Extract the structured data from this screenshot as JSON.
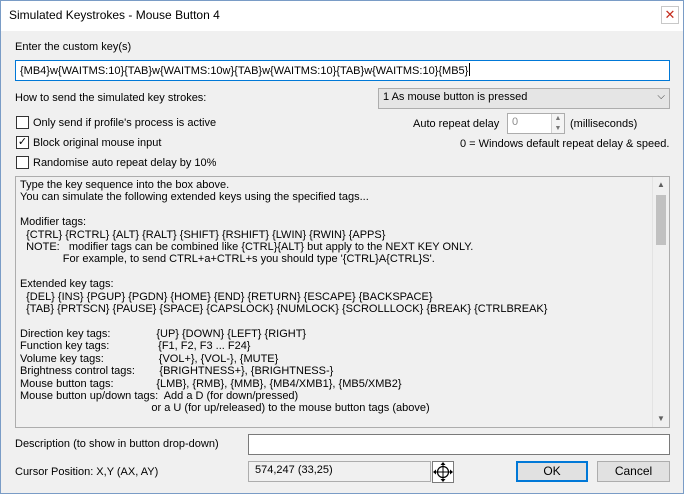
{
  "window": {
    "title": "Simulated Keystrokes - Mouse Button 4",
    "close_glyph": "✕"
  },
  "custom_key": {
    "label": "Enter the custom key(s)",
    "value": "{MB4}w{WAITMS:10}{TAB}w{WAITMS:10w}{TAB}w{WAITMS:10}{TAB}w{WAITMS:10}{MB5}"
  },
  "send_mode": {
    "label": "How to send the simulated key strokes:",
    "selected": "1 As mouse button is pressed",
    "arrow_icon": "chevron-down-icon"
  },
  "options": {
    "only_profile": {
      "label": "Only send if profile's process is active",
      "checked": false
    },
    "block_original": {
      "label": "Block original mouse input",
      "checked": true
    },
    "randomise": {
      "label": "Randomise auto repeat delay by 10%",
      "checked": false
    }
  },
  "auto_repeat": {
    "label": "Auto repeat delay",
    "value": "0",
    "unit": "(milliseconds)",
    "note": "0 = Windows default repeat delay & speed."
  },
  "help": {
    "text": "Type the key sequence into the box above.\nYou can simulate the following extended keys using the specified tags...\n\nModifier tags:\n  {CTRL} {RCTRL} {ALT} {RALT} {SHIFT} {RSHIFT} {LWIN} {RWIN} {APPS}\n  NOTE:   modifier tags can be combined like {CTRL}{ALT} but apply to the NEXT KEY ONLY.\n              For example, to send CTRL+a+CTRL+s you should type '{CTRL}A{CTRL}S'.\n\nExtended key tags:\n  {DEL} {INS} {PGUP} {PGDN} {HOME} {END} {RETURN} {ESCAPE} {BACKSPACE}\n  {TAB} {PRTSCN} {PAUSE} {SPACE} {CAPSLOCK} {NUMLOCK} {SCROLLLOCK} {BREAK} {CTRLBREAK}\n\nDirection key tags:               {UP} {DOWN} {LEFT} {RIGHT}\nFunction key tags:                {F1, F2, F3 ... F24}\nVolume key tags:                  {VOL+}, {VOL-}, {MUTE}\nBrightness control tags:        {BRIGHTNESS+}, {BRIGHTNESS-}\nMouse button tags:              {LMB}, {RMB}, {MMB}, {MB4/XMB1}, {MB5/XMB2}\nMouse button up/down tags:  Add a D (for down/pressed)\n                                           or a U (for up/released) to the mouse button tags (above)"
  },
  "description": {
    "label": "Description (to show in button drop-down)",
    "value": ""
  },
  "cursor": {
    "label": "Cursor Position: X,Y (AX, AY)",
    "value": "574,247 (33,25)",
    "target_icon": "crosshair-target-icon"
  },
  "buttons": {
    "ok": "OK",
    "cancel": "Cancel"
  }
}
